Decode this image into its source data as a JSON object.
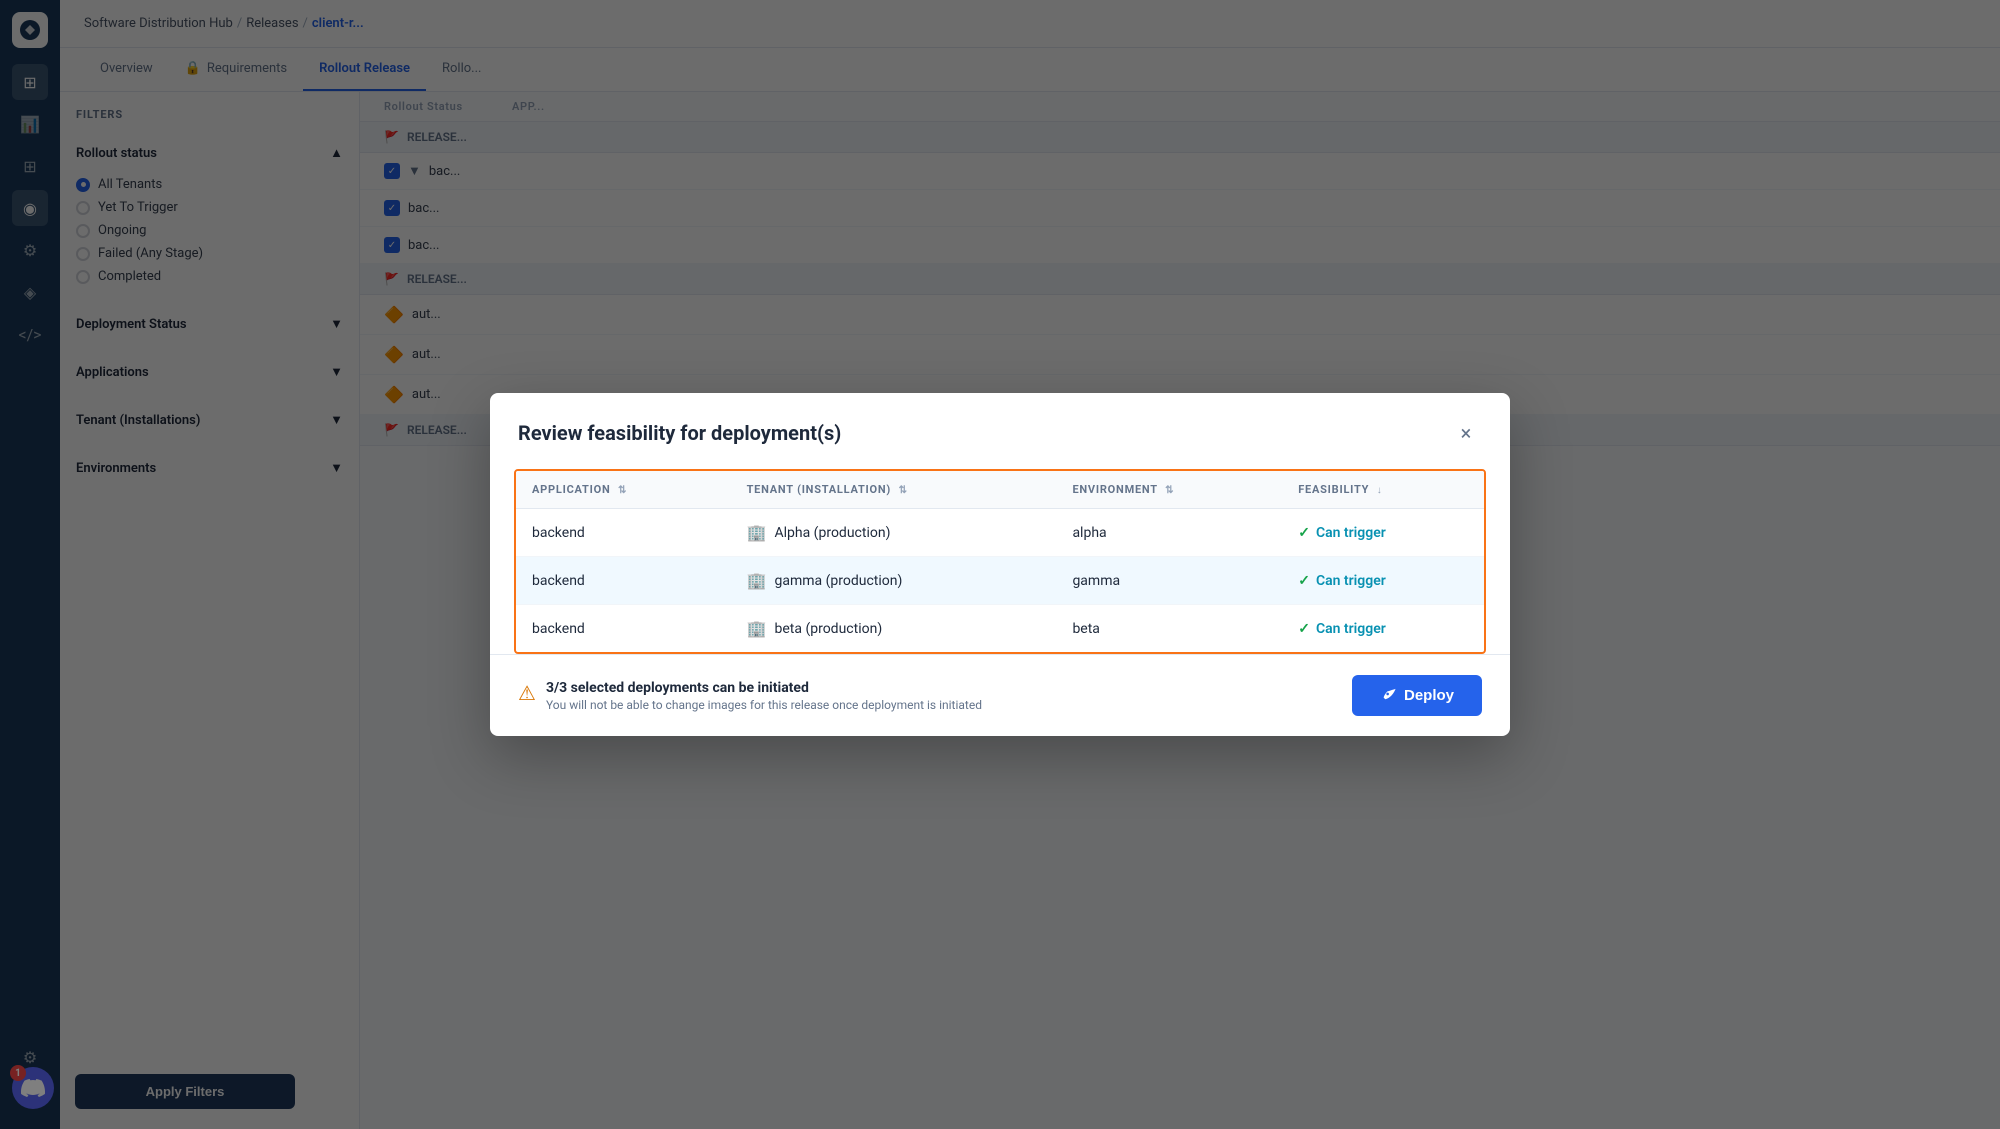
{
  "breadcrumb": {
    "parts": [
      "Software Distribution Hub",
      "Releases",
      "client-r..."
    ],
    "separators": [
      "/",
      "/"
    ]
  },
  "tabs": [
    {
      "id": "overview",
      "label": "Overview"
    },
    {
      "id": "requirements",
      "label": "Requirements",
      "icon": "🔒"
    },
    {
      "id": "rollout-release",
      "label": "Rollout Release",
      "active": true
    },
    {
      "id": "rollout2",
      "label": "Rollo..."
    }
  ],
  "filters": {
    "title": "FILTERS",
    "rollout_status_label": "Rollout status",
    "rollout_status_options": [
      {
        "id": "all",
        "label": "All Tenants",
        "selected": true
      },
      {
        "id": "yet",
        "label": "Yet To Trigger",
        "selected": false
      },
      {
        "id": "ongoing",
        "label": "Ongoing",
        "selected": false
      },
      {
        "id": "failed",
        "label": "Failed (Any Stage)",
        "selected": false
      },
      {
        "id": "completed",
        "label": "Completed",
        "selected": false
      }
    ],
    "deployment_status_label": "Deployment Status",
    "applications_label": "Applications",
    "tenant_label": "Tenant (Installations)",
    "environments_label": "Environments",
    "apply_button": "Apply Filters"
  },
  "list_header": {
    "rollout_status_label": "Rollout Status",
    "app_label": "APP..."
  },
  "release_groups": [
    {
      "flag": "🚩",
      "label": "RELEASE...",
      "items": [
        {
          "checkbox": true,
          "app": "bac..."
        },
        {
          "checkbox": true,
          "app": "bac..."
        },
        {
          "checkbox": true,
          "app": "bac..."
        }
      ]
    },
    {
      "flag": "🚩",
      "label": "RELEASE...",
      "items": [
        {
          "app": "aut..."
        },
        {
          "app": "aut..."
        },
        {
          "app": "aut..."
        }
      ]
    },
    {
      "flag": "🚩",
      "label": "RELEASE..."
    }
  ],
  "nav_icons": [
    "⊞",
    "📊",
    "⊞",
    "◉",
    "⚙",
    "◈",
    "</>",
    "⚙",
    "◉"
  ],
  "dialog": {
    "title": "Review feasibility for deployment(s)",
    "close_label": "×",
    "table": {
      "columns": [
        {
          "id": "application",
          "label": "APPLICATION",
          "sortable": true
        },
        {
          "id": "tenant",
          "label": "TENANT (INSTALLATION)",
          "sortable": true
        },
        {
          "id": "environment",
          "label": "ENVIRONMENT",
          "sortable": true
        },
        {
          "id": "feasibility",
          "label": "FEASIBILITY",
          "sortable": true,
          "sort_dir": "desc"
        }
      ],
      "rows": [
        {
          "application": "backend",
          "tenant": "Alpha (production)",
          "environment": "alpha",
          "feasibility": "Can trigger",
          "feasibility_ok": true
        },
        {
          "application": "backend",
          "tenant": "gamma (production)",
          "environment": "gamma",
          "feasibility": "Can trigger",
          "feasibility_ok": true,
          "highlighted": true
        },
        {
          "application": "backend",
          "tenant": "beta (production)",
          "environment": "beta",
          "feasibility": "Can trigger",
          "feasibility_ok": true
        }
      ]
    },
    "footer": {
      "summary": "3/3 selected deployments can be initiated",
      "warning": "You will not be able to change images for this release once deployment is initiated",
      "deploy_button": "Deploy",
      "warning_icon": "⚠"
    }
  },
  "discord": {
    "notification_count": "1"
  }
}
